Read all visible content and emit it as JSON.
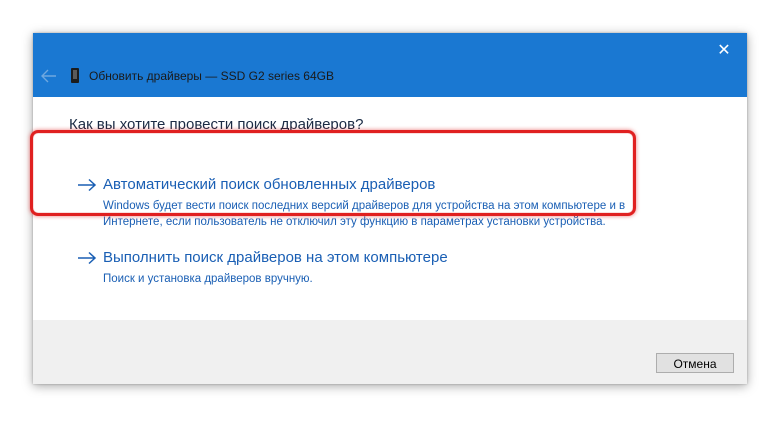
{
  "window": {
    "title": "Обновить драйверы — SSD G2 series 64GB",
    "close_glyph": "✕",
    "titlebar_color": "#1a78d2"
  },
  "content": {
    "question": "Как вы хотите провести поиск драйверов?",
    "options": [
      {
        "title": "Автоматический поиск обновленных драйверов",
        "description_line1": "Windows будет вести поиск последних версий драйверов для устройства на этом компьютере и в",
        "description_line2": "Интернете, если пользователь не отключил эту функцию в параметрах установки устройства.",
        "highlighted": true
      },
      {
        "title": "Выполнить поиск драйверов на этом компьютере",
        "description_line1": "Поиск и установка драйверов вручную."
      }
    ],
    "link_color": "#1a5fb4",
    "highlight_color": "#e02020"
  },
  "footer": {
    "cancel_label": "Отмена"
  }
}
